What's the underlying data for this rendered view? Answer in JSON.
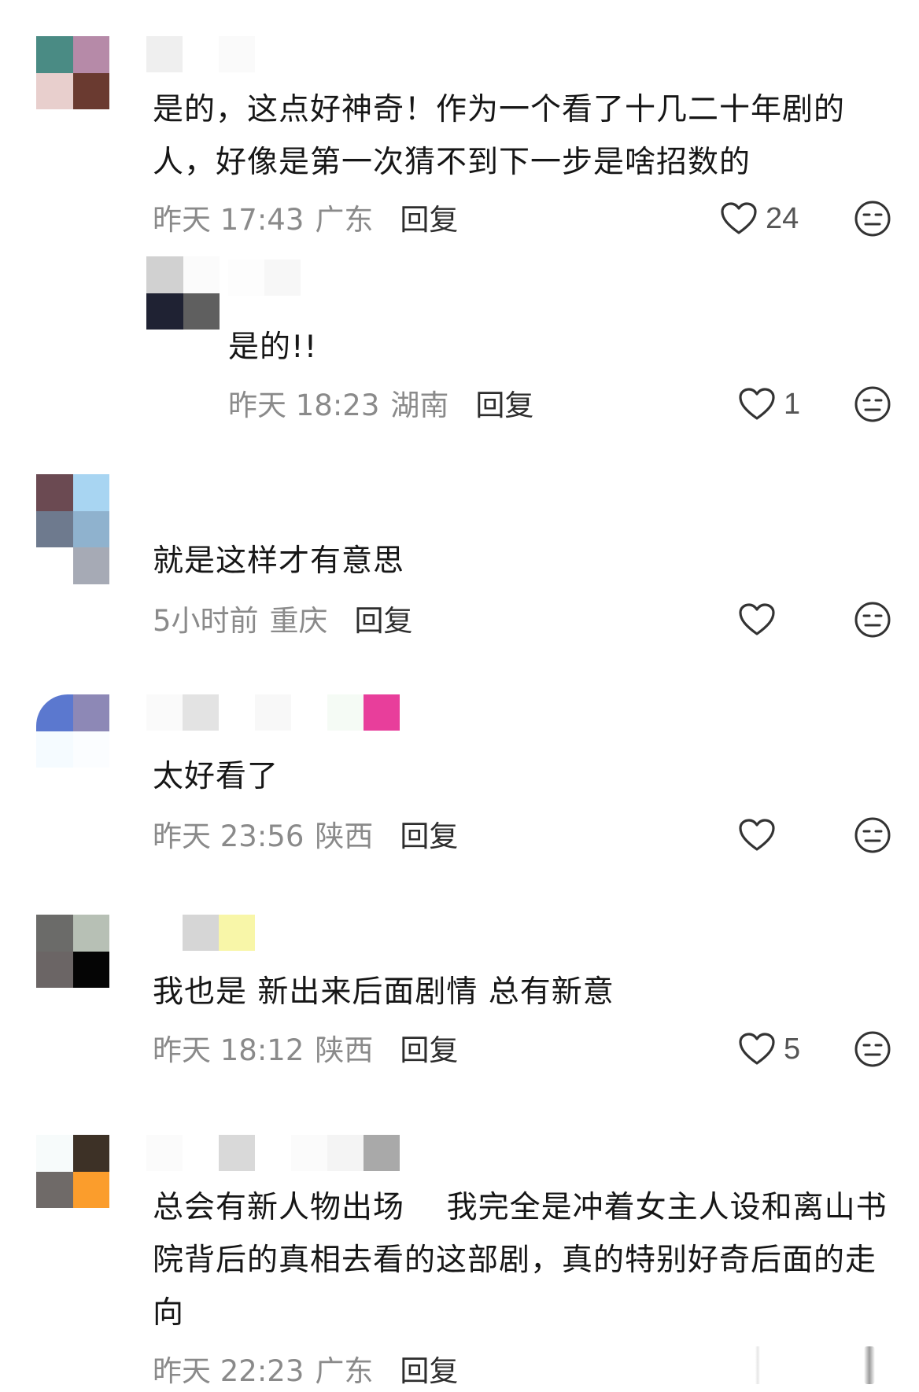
{
  "comments": [
    {
      "text": "是的，这点好神奇！作为一个看了十几二十年剧的人，好像是第一次猜不到下一步是啥招数的",
      "time": "昨天 17:43",
      "location": "广东",
      "reply_label": "回复",
      "likes": "24",
      "avatar_colors": [
        "#4a8b84",
        "#b68aa8",
        "#e8cfcd",
        "#6a3a30"
      ],
      "name_colors": [
        "#efefef",
        "#ffffff",
        "#fafafa",
        "#ffffff"
      ],
      "reply": {
        "text": "是的!!",
        "time": "昨天 18:23",
        "location": "湖南",
        "reply_label": "回复",
        "likes": "1",
        "avatar_colors": [
          "#d1d1d1",
          "#fbfbfb",
          "#1f2233",
          "#5f5f5f"
        ],
        "name_colors": [
          "#fdfdfd",
          "#f7f7f7",
          "#ffffff"
        ]
      }
    },
    {
      "text": "就是这样才有意思",
      "time": "5小时前",
      "location": "重庆",
      "reply_label": "回复",
      "likes": "",
      "avatar_colors": [
        "#6b4a52",
        "#a8d5f2",
        "#6e7a8e",
        "#8fb2ce",
        "#ffffff",
        "#a6aab5"
      ],
      "name_colors": []
    },
    {
      "text": "太好看了",
      "time": "昨天 23:56",
      "location": "陕西",
      "reply_label": "回复",
      "likes": "",
      "avatar_colors": [
        "#5b78cf",
        "#8d88b6",
        "#f5fbff",
        "#fbfdff"
      ],
      "name_colors": [
        "#fafafa",
        "#e3e3e3",
        "#ffffff",
        "#f8f8f8",
        "#ffffff",
        "#f5fbf5",
        "#e83e9b"
      ]
    },
    {
      "text": "我也是 新出来后面剧情 总有新意",
      "time": "昨天 18:12",
      "location": "陕西",
      "reply_label": "回复",
      "likes": "5",
      "avatar_colors": [
        "#6b6b69",
        "#b7c0b5",
        "#6b6565",
        "#050505"
      ],
      "name_colors": [
        "#ffffff",
        "#d6d6d6",
        "#f8f6a8"
      ]
    },
    {
      "text": "总会有新人物出场    我完全是冲着女主人设和离山书院背后的真相去看的这部剧，真的特别好奇后面的走向",
      "time": "昨天 22:23",
      "location": "广东",
      "reply_label": "回复",
      "likes": "",
      "avatar_colors": [
        "#f7fbfb",
        "#3d3126",
        "#6f6a68",
        "#fb9d2c"
      ],
      "name_colors": [
        "#fbfbfb",
        "#ffffff",
        "#d9d9d9",
        "#ffffff",
        "#fbfbfb",
        "#f4f4f4",
        "#a9a9a9"
      ]
    }
  ],
  "icons": {
    "like": "heart-outline-icon",
    "more": "neutral-face-icon"
  },
  "colors": {
    "text": "#161616",
    "meta": "#8a8a8a",
    "reply": "#2d2d2d",
    "icon": "#333333"
  }
}
